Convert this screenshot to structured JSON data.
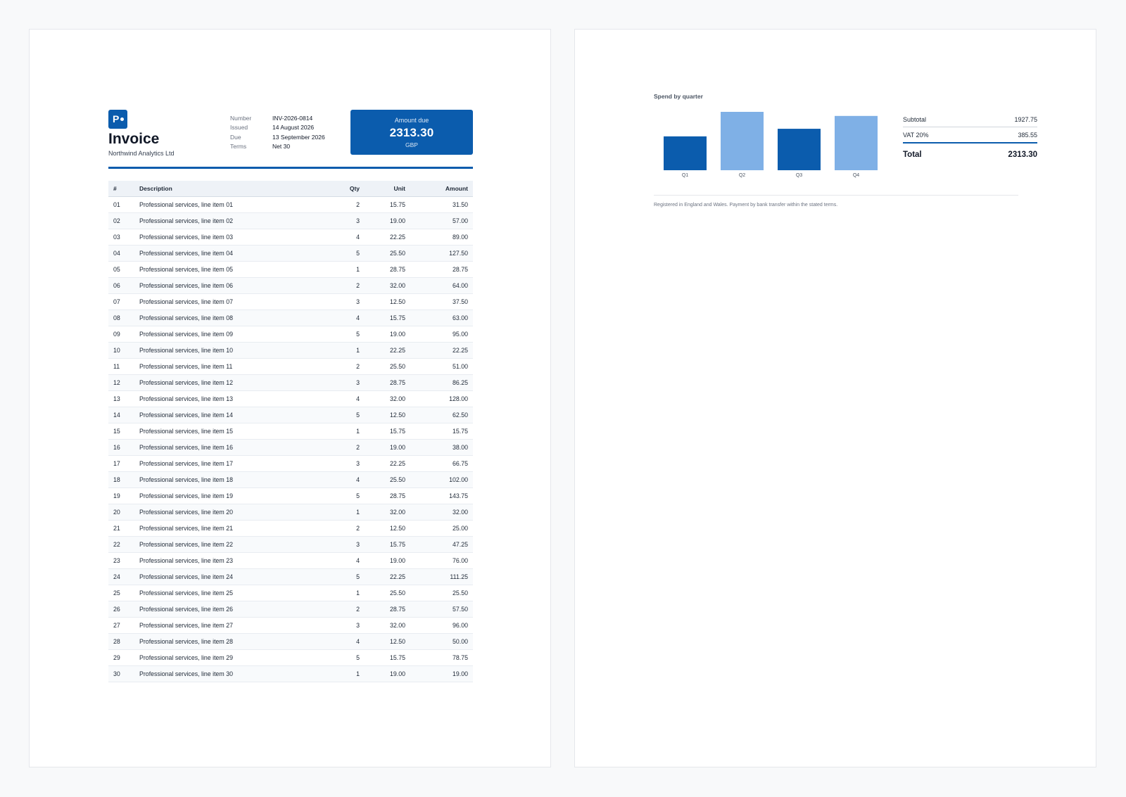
{
  "header": {
    "logo_letter": "P",
    "title": "Invoice",
    "company": "Northwind Analytics Ltd",
    "meta": [
      {
        "label": "Number",
        "value": "INV-2026-0814"
      },
      {
        "label": "Issued",
        "value": "14 August 2026"
      },
      {
        "label": "Due",
        "value": "13 September 2026"
      },
      {
        "label": "Terms",
        "value": "Net 30"
      }
    ],
    "amount_due_label": "Amount due",
    "amount_due": "2313.30",
    "currency": "GBP"
  },
  "table": {
    "headers": {
      "num": "#",
      "description": "Description",
      "qty": "Qty",
      "unit": "Unit",
      "amount": "Amount"
    },
    "rows": [
      {
        "num": "01",
        "description": "Professional services, line item 01",
        "qty": "2",
        "unit": "15.75",
        "amount": "31.50"
      },
      {
        "num": "02",
        "description": "Professional services, line item 02",
        "qty": "3",
        "unit": "19.00",
        "amount": "57.00"
      },
      {
        "num": "03",
        "description": "Professional services, line item 03",
        "qty": "4",
        "unit": "22.25",
        "amount": "89.00"
      },
      {
        "num": "04",
        "description": "Professional services, line item 04",
        "qty": "5",
        "unit": "25.50",
        "amount": "127.50"
      },
      {
        "num": "05",
        "description": "Professional services, line item 05",
        "qty": "1",
        "unit": "28.75",
        "amount": "28.75"
      },
      {
        "num": "06",
        "description": "Professional services, line item 06",
        "qty": "2",
        "unit": "32.00",
        "amount": "64.00"
      },
      {
        "num": "07",
        "description": "Professional services, line item 07",
        "qty": "3",
        "unit": "12.50",
        "amount": "37.50"
      },
      {
        "num": "08",
        "description": "Professional services, line item 08",
        "qty": "4",
        "unit": "15.75",
        "amount": "63.00"
      },
      {
        "num": "09",
        "description": "Professional services, line item 09",
        "qty": "5",
        "unit": "19.00",
        "amount": "95.00"
      },
      {
        "num": "10",
        "description": "Professional services, line item 10",
        "qty": "1",
        "unit": "22.25",
        "amount": "22.25"
      },
      {
        "num": "11",
        "description": "Professional services, line item 11",
        "qty": "2",
        "unit": "25.50",
        "amount": "51.00"
      },
      {
        "num": "12",
        "description": "Professional services, line item 12",
        "qty": "3",
        "unit": "28.75",
        "amount": "86.25"
      },
      {
        "num": "13",
        "description": "Professional services, line item 13",
        "qty": "4",
        "unit": "32.00",
        "amount": "128.00"
      },
      {
        "num": "14",
        "description": "Professional services, line item 14",
        "qty": "5",
        "unit": "12.50",
        "amount": "62.50"
      },
      {
        "num": "15",
        "description": "Professional services, line item 15",
        "qty": "1",
        "unit": "15.75",
        "amount": "15.75"
      },
      {
        "num": "16",
        "description": "Professional services, line item 16",
        "qty": "2",
        "unit": "19.00",
        "amount": "38.00"
      },
      {
        "num": "17",
        "description": "Professional services, line item 17",
        "qty": "3",
        "unit": "22.25",
        "amount": "66.75"
      },
      {
        "num": "18",
        "description": "Professional services, line item 18",
        "qty": "4",
        "unit": "25.50",
        "amount": "102.00"
      },
      {
        "num": "19",
        "description": "Professional services, line item 19",
        "qty": "5",
        "unit": "28.75",
        "amount": "143.75"
      },
      {
        "num": "20",
        "description": "Professional services, line item 20",
        "qty": "1",
        "unit": "32.00",
        "amount": "32.00"
      },
      {
        "num": "21",
        "description": "Professional services, line item 21",
        "qty": "2",
        "unit": "12.50",
        "amount": "25.00"
      },
      {
        "num": "22",
        "description": "Professional services, line item 22",
        "qty": "3",
        "unit": "15.75",
        "amount": "47.25"
      },
      {
        "num": "23",
        "description": "Professional services, line item 23",
        "qty": "4",
        "unit": "19.00",
        "amount": "76.00"
      },
      {
        "num": "24",
        "description": "Professional services, line item 24",
        "qty": "5",
        "unit": "22.25",
        "amount": "111.25"
      },
      {
        "num": "25",
        "description": "Professional services, line item 25",
        "qty": "1",
        "unit": "25.50",
        "amount": "25.50"
      },
      {
        "num": "26",
        "description": "Professional services, line item 26",
        "qty": "2",
        "unit": "28.75",
        "amount": "57.50"
      },
      {
        "num": "27",
        "description": "Professional services, line item 27",
        "qty": "3",
        "unit": "32.00",
        "amount": "96.00"
      },
      {
        "num": "28",
        "description": "Professional services, line item 28",
        "qty": "4",
        "unit": "12.50",
        "amount": "50.00"
      },
      {
        "num": "29",
        "description": "Professional services, line item 29",
        "qty": "5",
        "unit": "15.75",
        "amount": "78.75"
      },
      {
        "num": "30",
        "description": "Professional services, line item 30",
        "qty": "1",
        "unit": "19.00",
        "amount": "19.00"
      }
    ]
  },
  "chart_data": {
    "type": "bar",
    "title": "Spend by quarter",
    "categories": [
      "Q1",
      "Q2",
      "Q3",
      "Q4"
    ],
    "values": [
      58,
      100,
      71,
      93
    ],
    "colors": [
      "#0b5cad",
      "#7fb0e6",
      "#0b5cad",
      "#7fb0e6"
    ],
    "ylim": [
      0,
      100
    ],
    "grid": false,
    "xlabel": "",
    "ylabel": ""
  },
  "totals": {
    "subtotal_label": "Subtotal",
    "subtotal": "1927.75",
    "vat_label": "VAT 20%",
    "vat": "385.55",
    "total_label": "Total",
    "total": "2313.30"
  },
  "footer": {
    "note": "Registered in England and Wales. Payment by bank transfer within the stated terms."
  },
  "colors": {
    "accent": "#0b5cad",
    "accent_light": "#7fb0e6"
  }
}
